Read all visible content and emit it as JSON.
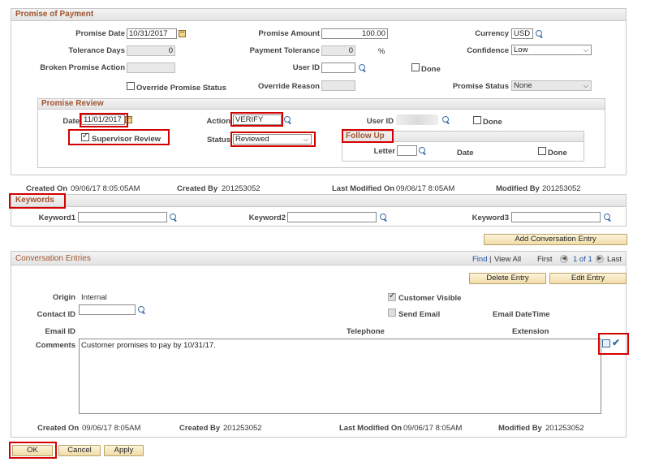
{
  "promise": {
    "title": "Promise of Payment",
    "promise_date_label": "Promise Date",
    "promise_date": "10/31/2017",
    "promise_amount_label": "Promise Amount",
    "promise_amount": "100.00",
    "currency_label": "Currency",
    "currency": "USD",
    "tolerance_days_label": "Tolerance Days",
    "tolerance_days": "0",
    "payment_tolerance_label": "Payment Tolerance",
    "payment_tolerance": "0",
    "percent": "%",
    "confidence_label": "Confidence",
    "confidence": "Low",
    "broken_action_label": "Broken Promise Action",
    "broken_action": "",
    "user_id_label": "User ID",
    "user_id": "",
    "done_label": "Done",
    "override_status_label": "Override Promise Status",
    "override_reason_label": "Override Reason",
    "override_reason": "",
    "promise_status_label": "Promise Status",
    "promise_status": "None"
  },
  "review": {
    "title": "Promise Review",
    "date_label": "Date",
    "date": "11/01/2017",
    "action_label": "Action",
    "action": "VERIFY",
    "user_id_label": "User ID",
    "done_label": "Done",
    "supervisor_review_label": "Supervisor Review",
    "status_label": "Status",
    "status": "Reviewed",
    "follow_up_title": "Follow Up",
    "letter_label": "Letter",
    "letter": "",
    "fu_date_label": "Date",
    "fu_done_label": "Done"
  },
  "audit": {
    "created_on_label": "Created On",
    "created_on": "09/06/17  8:05:05AM",
    "created_by_label": "Created By",
    "created_by": "201253052",
    "last_modified_label": "Last Modified On",
    "last_modified": "09/06/17  8:05AM",
    "modified_by_label": "Modified By",
    "modified_by": "201253052"
  },
  "keywords": {
    "title": "Keywords",
    "k1_label": "Keyword1",
    "k2_label": "Keyword2",
    "k3_label": "Keyword3",
    "k1": "",
    "k2": "",
    "k3": ""
  },
  "conversation": {
    "add_button": "Add Conversation Entry",
    "title": "Conversation Entries",
    "find": "Find",
    "sep": "|",
    "view_all": "View All",
    "first": "First",
    "page": "1 of 1",
    "last": "Last",
    "delete_button": "Delete Entry",
    "edit_button": "Edit Entry",
    "origin_label": "Origin",
    "origin": "Internal",
    "customer_visible_label": "Customer Visible",
    "contact_id_label": "Contact ID",
    "contact_id": "",
    "send_email_label": "Send Email",
    "email_datetime_label": "Email DateTime",
    "email_id_label": "Email ID",
    "telephone_label": "Telephone",
    "extension_label": "Extension",
    "comments_label": "Comments",
    "comments": "Customer promises to pay by 10/31/17.",
    "created_on_label": "Created On",
    "created_on": "09/06/17  8:05AM",
    "created_by_label": "Created By",
    "created_by": "201253052",
    "last_modified_label": "Last Modified On",
    "last_modified": "09/06/17  8:05AM",
    "modified_by_label": "Modified By",
    "modified_by": "201253052"
  },
  "footer": {
    "ok": "OK",
    "cancel": "Cancel",
    "apply": "Apply"
  },
  "colors": {
    "section_title": "#a0522d",
    "highlight": "#d40000",
    "button_bg": "#f0dca8",
    "link": "#1f4fa0"
  }
}
